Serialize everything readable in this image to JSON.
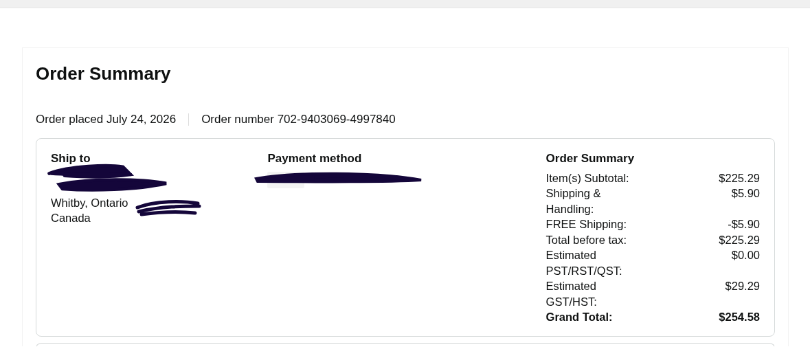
{
  "title": "Order Summary",
  "meta": [
    {
      "text": "Order placed July 24, 2026"
    },
    {
      "text": "Order number 702-9403069-4997840"
    }
  ],
  "ship_to": {
    "heading": "Ship to",
    "lines": [
      "Whitby, Ontario",
      "Canada"
    ]
  },
  "payment": {
    "heading": "Payment method"
  },
  "summary": {
    "heading": "Order Summary",
    "rows": [
      {
        "label": "Item(s) Subtotal:",
        "value": "$225.29",
        "kind": "normal"
      },
      {
        "label": "Shipping & Handling:",
        "value": "$5.90",
        "kind": "normal"
      },
      {
        "label": "FREE Shipping:",
        "value": "-$5.90",
        "kind": "normal"
      },
      {
        "label": "Total before tax:",
        "value": "$225.29",
        "kind": "normal"
      },
      {
        "label": "Estimated PST/RST/QST:",
        "value": "$0.00",
        "kind": "normal"
      },
      {
        "label": "Estimated GST/HST:",
        "value": "$29.29",
        "kind": "normal"
      },
      {
        "label": "Grand Total:",
        "value": "$254.58",
        "kind": "total"
      }
    ]
  }
}
